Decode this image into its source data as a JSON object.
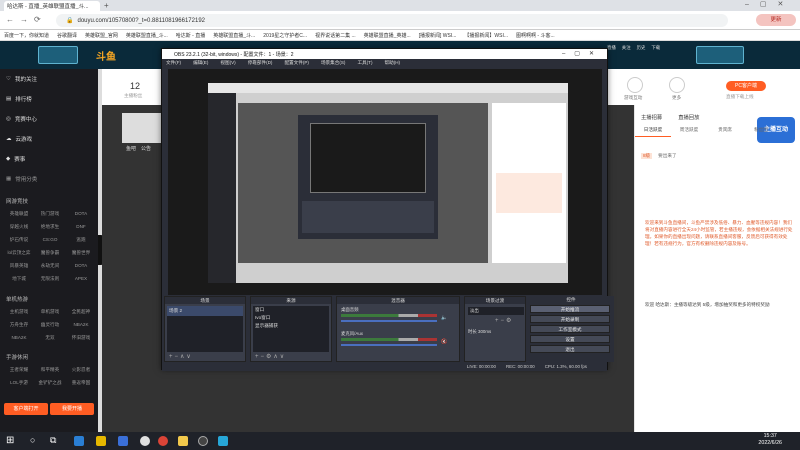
{
  "browser": {
    "tabs": [
      {
        "title": "哈达斯 - 直播_英雄联盟直播_斗..."
      },
      {
        "title": ""
      }
    ],
    "url": "douyu.com/10570800?_t=0.8811081966172192",
    "bookmarks": [
      "百度一下，你就知道",
      "谷歌翻译",
      "英雄联盟_官网",
      "英雄联盟直播_斗...",
      "哈达斯 - 直播",
      "英雄联盟直播_斗...",
      "2019星之守护者C...",
      "视界说话第二集 ...",
      "英雄联盟直播_英雄...",
      "[播报新闻] WSI...",
      "【播报新闻】WSI...",
      "图啊啊啊 - 斗客..."
    ],
    "profile_label": "更新"
  },
  "site": {
    "header_count": "12",
    "header_count_label": "主播粉丝",
    "header_icons": [
      "直播",
      "关注",
      "历史",
      "下载"
    ],
    "pc_badge": "PC客户端",
    "pc_sub": "直播下载上线",
    "anchor_name": "鱼吧",
    "anchor_label": "公告",
    "task_label": "游戏互动",
    "more_label": "更多"
  },
  "sidebar": {
    "items": [
      {
        "label": "我的关注"
      },
      {
        "label": "排行榜"
      },
      {
        "label": "竞赛中心"
      },
      {
        "label": "云游戏"
      },
      {
        "label": "赛事"
      }
    ],
    "sections": [
      {
        "title": "常用分类"
      },
      {
        "title": "网游竞技",
        "rows": [
          [
            "英雄联盟",
            "热门游戏",
            "DOTA"
          ],
          [
            "穿越火线",
            "绝地求生",
            "DNF"
          ],
          [
            "炉石传说",
            "CS:GO",
            "逃跑"
          ],
          [
            "lol云顶之弈",
            "魔兽争霸",
            "魔兽世界"
          ],
          [
            "风暴英雄",
            "永劫无间",
            "DOTA"
          ],
          [
            "地下城",
            "无限法则",
            "APEX"
          ]
        ]
      },
      {
        "title": "单机热游",
        "rows": [
          [
            "主机游戏",
            "单机游戏",
            "全民超神"
          ],
          [
            "方舟生存",
            "幽灵行动",
            "NBA2K"
          ],
          [
            "NBA2K",
            "无双",
            "怀旧游戏"
          ]
        ]
      },
      {
        "title": "手游休闲",
        "rows": [
          [
            "王者荣耀",
            "和平精英",
            "火影忍者"
          ],
          [
            "LOL手游",
            "金铲铲之战",
            "重返帝国"
          ]
        ]
      }
    ],
    "bottom_buttons": [
      {
        "label": "客户端打开"
      },
      {
        "label": "我要开播"
      }
    ]
  },
  "chat": {
    "tabs": [
      "主播招募",
      "直播回放"
    ],
    "sub_tabs": [
      "日活跃度",
      "周活跃度",
      "贵宾席",
      "粉丝团"
    ],
    "badge_label": "主播互动",
    "entry_user": "8级",
    "entry_text": "要出来了",
    "notice": "欢迎来到斗鱼直播间，斗鱼严禁涉及低俗、暴力、血腥等违规内容！我们将对直播内容进行全天24小时监管，若主播违规，会依据相关法规进行处理。如果你的直播出现问题，请联系直播间客服，反馈后可获得有效处理！若有违规行为，官方有权删除违规内容及账号。",
    "notice2": "欢迎 哈达斯：主播等级达到 5级，增加抽奖和更多的特权奖励"
  },
  "obs": {
    "title": "OBS 23.2.1 (32-bit, windows) - 配置文件：1 - 场景：2",
    "menu": [
      "文件(F)",
      "编辑(E)",
      "视图(V)",
      "停靠部件(D)",
      "配置文件(P)",
      "场景集合(S)",
      "工具(T)",
      "帮助(H)"
    ],
    "docks": [
      {
        "title": "场景",
        "items": [
          "场景 2"
        ]
      },
      {
        "title": "来源",
        "items": [
          "窗口",
          "Ivo窗口",
          "显示器捕获"
        ]
      },
      {
        "title": "混音器",
        "items": [
          "桌面音频",
          "麦克风/Aux"
        ]
      },
      {
        "title": "场景过渡",
        "items": [
          "淡出",
          "时长  300ms"
        ]
      }
    ],
    "controls": [
      "开始推流",
      "开始录制",
      "工作室模式",
      "设置",
      "退出"
    ],
    "status": [
      "LIVE: 00:00:00",
      "REC: 00:00:00",
      "CPU: 1.3%, 60.00 fps"
    ]
  },
  "taskbar": {
    "time": "15:37",
    "date": "2022/6/26"
  }
}
